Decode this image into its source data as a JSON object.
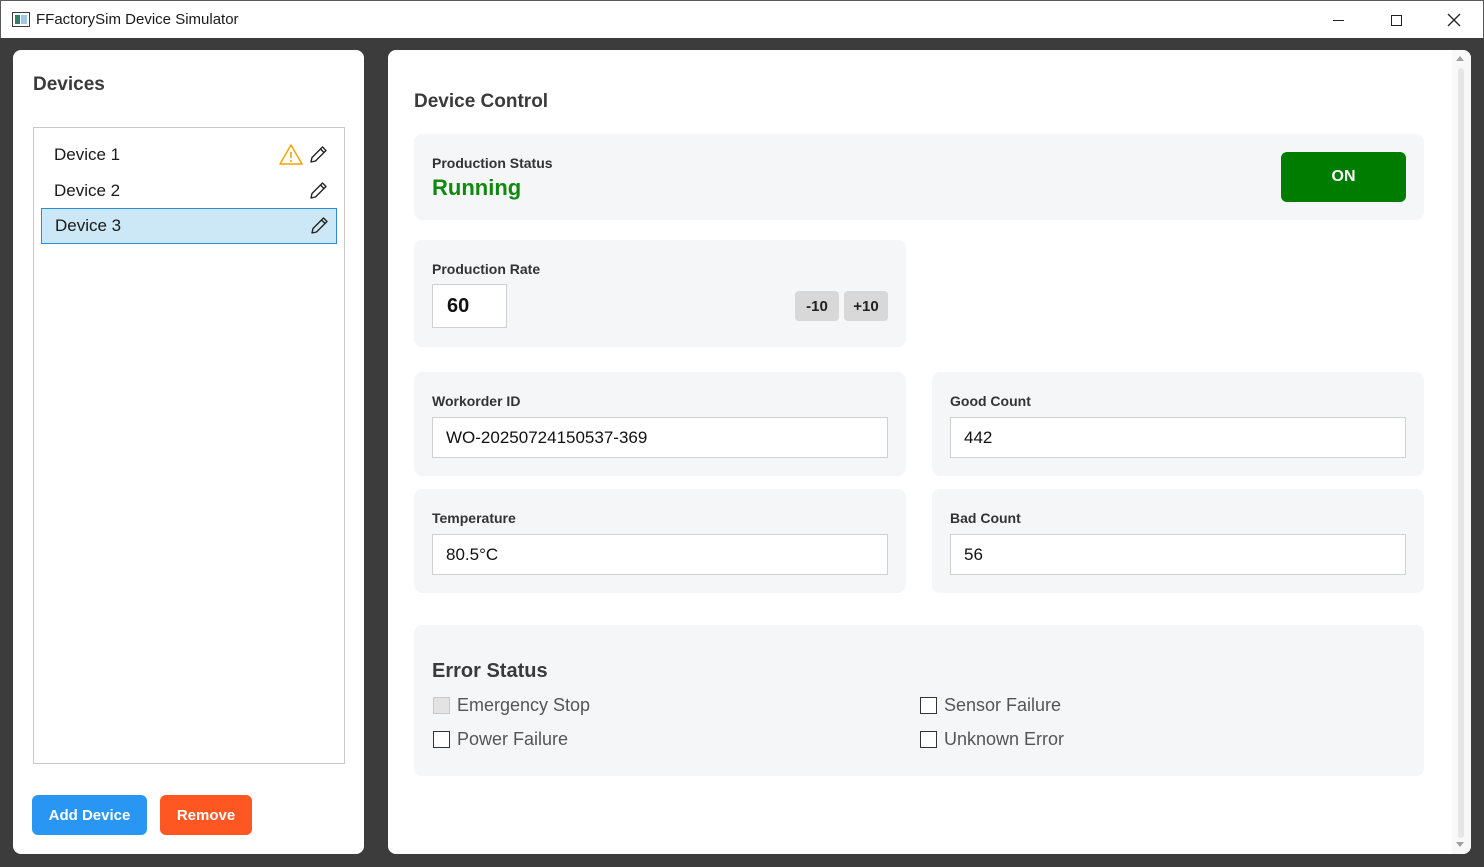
{
  "window": {
    "title": "FFactorySim Device Simulator",
    "controls": [
      "minimize",
      "maximize",
      "close"
    ]
  },
  "sidebar": {
    "title": "Devices",
    "devices": [
      {
        "label": "Device 1",
        "warning": true,
        "selected": false
      },
      {
        "label": "Device 2",
        "warning": false,
        "selected": false
      },
      {
        "label": "Device 3",
        "warning": false,
        "selected": true
      }
    ],
    "add_label": "Add Device",
    "remove_label": "Remove"
  },
  "control": {
    "title": "Device Control",
    "production_status": {
      "label": "Production Status",
      "value": "Running",
      "toggle_label": "ON"
    },
    "production_rate": {
      "label": "Production Rate",
      "value": "60",
      "decrement_label": "-10",
      "increment_label": "+10"
    },
    "workorder": {
      "label": "Workorder ID",
      "value": "WO-20250724150537-369"
    },
    "good_count": {
      "label": "Good Count",
      "value": "442"
    },
    "temperature": {
      "label": "Temperature",
      "value": "80.5°C"
    },
    "bad_count": {
      "label": "Bad Count",
      "value": "56"
    }
  },
  "errors": {
    "title": "Error Status",
    "items": [
      {
        "label": "Emergency Stop",
        "checked": false,
        "disabled": true
      },
      {
        "label": "Sensor Failure",
        "checked": false,
        "disabled": false
      },
      {
        "label": "Power Failure",
        "checked": false,
        "disabled": false
      },
      {
        "label": "Unknown Error",
        "checked": false,
        "disabled": false
      }
    ]
  },
  "colors": {
    "running": "#0f8a0f",
    "on_button": "#007d00",
    "add_button": "#2a96f3",
    "remove_button": "#fe5722",
    "selection": "#cce8f6",
    "warning": "#f0a400"
  }
}
